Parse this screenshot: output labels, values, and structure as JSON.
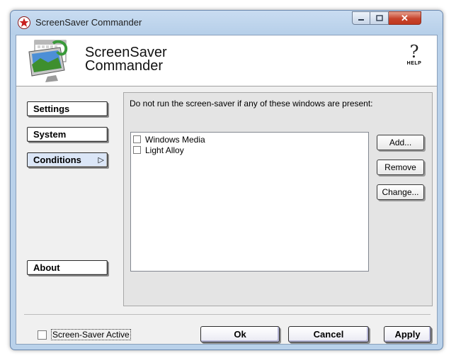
{
  "window": {
    "title": "ScreenSaver Commander"
  },
  "header": {
    "product_line1": "ScreenSaver",
    "product_line2": "Commander",
    "help_label": "HELP"
  },
  "nav": [
    {
      "label": "Settings"
    },
    {
      "label": "System"
    },
    {
      "label": "Conditions",
      "active": true
    },
    {
      "label": "About"
    }
  ],
  "conditions": {
    "description": "Do not run the screen-saver if any of these windows are present:",
    "windows": [
      {
        "label": "Windows Media",
        "checked": false
      },
      {
        "label": "Light Alloy",
        "checked": false
      }
    ],
    "add_label": "Add...",
    "remove_label": "Remove",
    "change_label": "Change..."
  },
  "footer": {
    "screensaver_active_label": "Screen-Saver Active",
    "screensaver_active_checked": false,
    "ok_label": "Ok",
    "cancel_label": "Cancel",
    "apply_label": "Apply"
  },
  "icons": {
    "app": "red-star-icon",
    "help": "question-mark-icon",
    "logo": "monitor-calendar-icon",
    "nav_arrow": "triangle-right-icon"
  }
}
